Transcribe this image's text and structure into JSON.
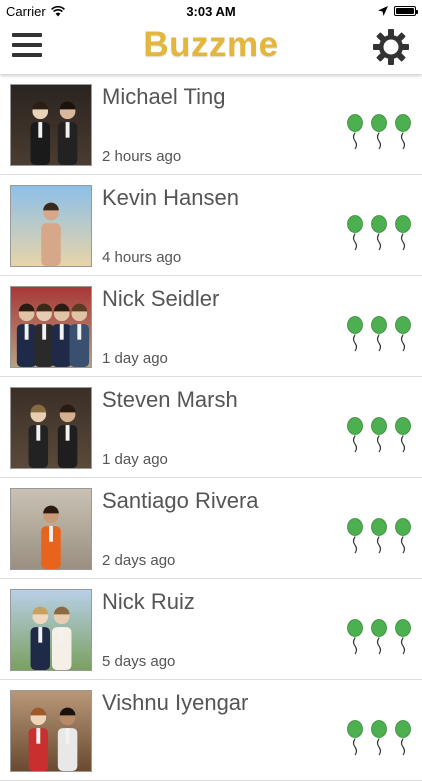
{
  "status_bar": {
    "carrier": "Carrier",
    "time": "3:03 AM",
    "battery_percent": 100
  },
  "nav": {
    "title": "Buzzme",
    "title_color": "#e3b63e",
    "menu_icon": "hamburger-menu-icon",
    "settings_icon": "gear-icon"
  },
  "balloon_color": "#4caf50",
  "contacts": [
    {
      "name": "Michael Ting",
      "time": "2 hours ago",
      "balloons": 3
    },
    {
      "name": "Kevin Hansen",
      "time": "4 hours ago",
      "balloons": 3
    },
    {
      "name": "Nick Seidler",
      "time": "1 day ago",
      "balloons": 3
    },
    {
      "name": "Steven Marsh",
      "time": "1 day ago",
      "balloons": 3
    },
    {
      "name": "Santiago Rivera",
      "time": "2 days ago",
      "balloons": 3
    },
    {
      "name": "Nick Ruiz",
      "time": "5 days ago",
      "balloons": 3
    },
    {
      "name": "Vishnu Iyengar",
      "time": "",
      "balloons": 3
    }
  ]
}
